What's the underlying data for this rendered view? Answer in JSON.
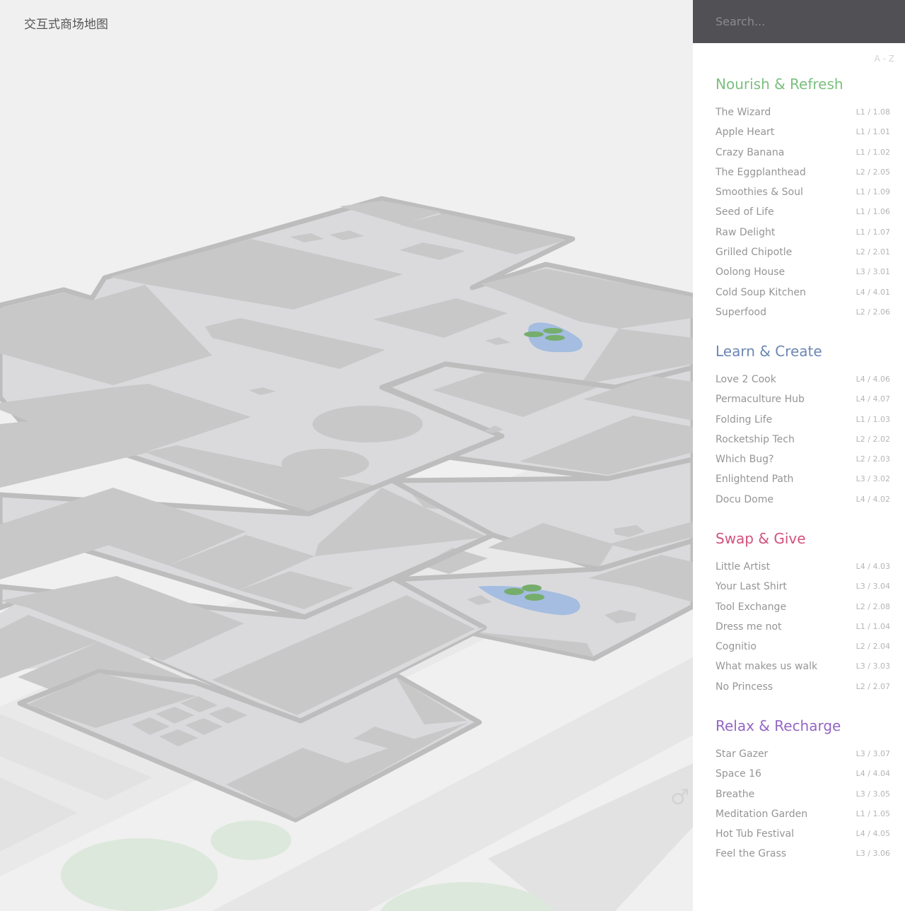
{
  "map": {
    "title": "交互式商场地图"
  },
  "search": {
    "placeholder": "Search..."
  },
  "sort": {
    "label": "A - Z"
  },
  "colors": {
    "nourish": "#7abf7e",
    "learn": "#6c86b4",
    "swap": "#d2527f",
    "relax": "#9466c4",
    "water": "#a4bde0",
    "lilypad": "#76ad6c",
    "park": "#dde8dc"
  },
  "categories": [
    {
      "title": "Nourish & Refresh",
      "color": "#7abf7e",
      "stores": [
        {
          "name": "The Wizard",
          "location": "L1 / 1.08"
        },
        {
          "name": "Apple Heart",
          "location": "L1 / 1.01"
        },
        {
          "name": "Crazy Banana",
          "location": "L1 / 1.02"
        },
        {
          "name": "The Eggplanthead",
          "location": "L2 / 2.05"
        },
        {
          "name": "Smoothies & Soul",
          "location": "L1 / 1.09"
        },
        {
          "name": "Seed of Life",
          "location": "L1 / 1.06"
        },
        {
          "name": "Raw Delight",
          "location": "L1 / 1.07"
        },
        {
          "name": "Grilled Chipotle",
          "location": "L2 / 2.01"
        },
        {
          "name": "Oolong House",
          "location": "L3 / 3.01"
        },
        {
          "name": "Cold Soup Kitchen",
          "location": "L4 / 4.01"
        },
        {
          "name": "Superfood",
          "location": "L2 / 2.06"
        }
      ]
    },
    {
      "title": "Learn & Create",
      "color": "#6c86b4",
      "stores": [
        {
          "name": "Love 2 Cook",
          "location": "L4 / 4.06"
        },
        {
          "name": "Permaculture Hub",
          "location": "L4 / 4.07"
        },
        {
          "name": "Folding Life",
          "location": "L1 / 1.03"
        },
        {
          "name": "Rocketship Tech",
          "location": "L2 / 2.02"
        },
        {
          "name": "Which Bug?",
          "location": "L2 / 2.03"
        },
        {
          "name": "Enlightend Path",
          "location": "L3 / 3.02"
        },
        {
          "name": "Docu Dome",
          "location": "L4 / 4.02"
        }
      ]
    },
    {
      "title": "Swap & Give",
      "color": "#d2527f",
      "stores": [
        {
          "name": "Little Artist",
          "location": "L4 / 4.03"
        },
        {
          "name": "Your Last Shirt",
          "location": "L3 / 3.04"
        },
        {
          "name": "Tool Exchange",
          "location": "L2 / 2.08"
        },
        {
          "name": "Dress me not",
          "location": "L1 / 1.04"
        },
        {
          "name": "Cognitio",
          "location": "L2 / 2.04"
        },
        {
          "name": "What makes us walk",
          "location": "L3 / 3.03"
        },
        {
          "name": "No Princess",
          "location": "L2 / 2.07"
        }
      ]
    },
    {
      "title": "Relax & Recharge",
      "color": "#9466c4",
      "stores": [
        {
          "name": "Star Gazer",
          "location": "L3 / 3.07"
        },
        {
          "name": "Space 16",
          "location": "L4 / 4.04"
        },
        {
          "name": "Breathe",
          "location": "L3 / 3.05"
        },
        {
          "name": "Meditation Garden",
          "location": "L1 / 1.05"
        },
        {
          "name": "Hot Tub Festival",
          "location": "L4 / 4.05"
        },
        {
          "name": "Feel the Grass",
          "location": "L3 / 3.06"
        }
      ]
    }
  ]
}
